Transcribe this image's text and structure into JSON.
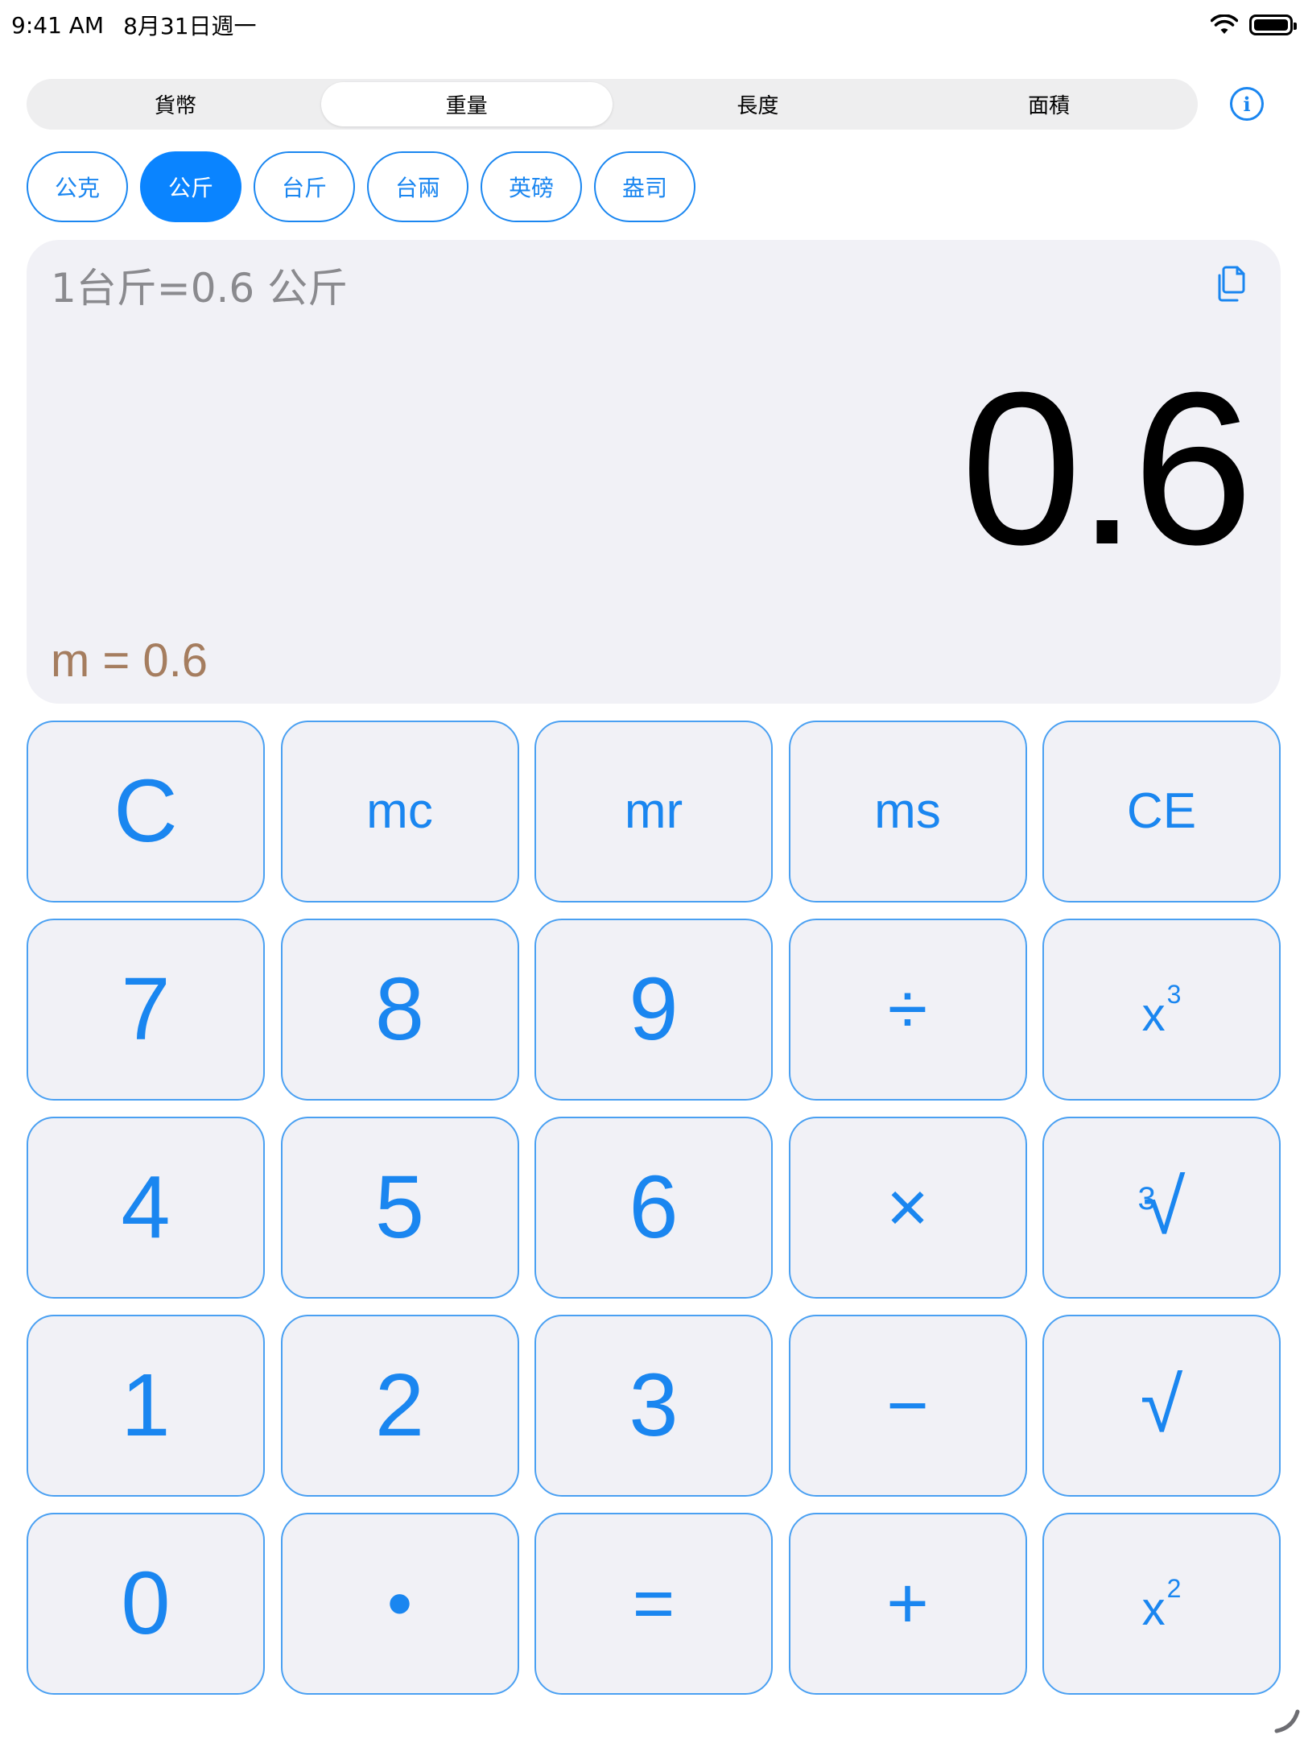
{
  "status_bar": {
    "time": "9:41 AM",
    "date": "8月31日週一",
    "wifi_icon": "wifi-icon",
    "battery_icon": "battery-full-icon"
  },
  "segments": [
    {
      "label": "貨幣",
      "active": false
    },
    {
      "label": "重量",
      "active": true
    },
    {
      "label": "長度",
      "active": false
    },
    {
      "label": "面積",
      "active": false
    }
  ],
  "info_icon": "info-circle-icon",
  "info_glyph": "i",
  "units": [
    {
      "label": "公克",
      "active": false
    },
    {
      "label": "公斤",
      "active": true
    },
    {
      "label": "台斤",
      "active": false
    },
    {
      "label": "台兩",
      "active": false
    },
    {
      "label": "英磅",
      "active": false
    },
    {
      "label": "盎司",
      "active": false
    }
  ],
  "display": {
    "formula": "1台斤=0.6 公斤",
    "result": "0.6",
    "memory": "m = 0.6",
    "copy_icon": "copy-icon"
  },
  "keys": {
    "c": "C",
    "mc": "mc",
    "mr": "mr",
    "ms": "ms",
    "ce": "CE",
    "seven": "7",
    "eight": "8",
    "nine": "9",
    "divide": "÷",
    "cube_base": "x",
    "cube_exp": "3",
    "four": "4",
    "five": "5",
    "six": "6",
    "multiply": "×",
    "cbrt_index": "3",
    "cbrt_sign": "√",
    "one": "1",
    "two": "2",
    "three": "3",
    "minus": "−",
    "sqrt": "√",
    "zero": "0",
    "dot": "•",
    "equals": "=",
    "plus": "+",
    "square_base": "x",
    "square_exp": "2"
  },
  "colors": {
    "accent": "#1a86f0",
    "active_chip": "#0a84ff",
    "memory_text": "#a57d5f",
    "display_bg": "#f1f1f6"
  }
}
